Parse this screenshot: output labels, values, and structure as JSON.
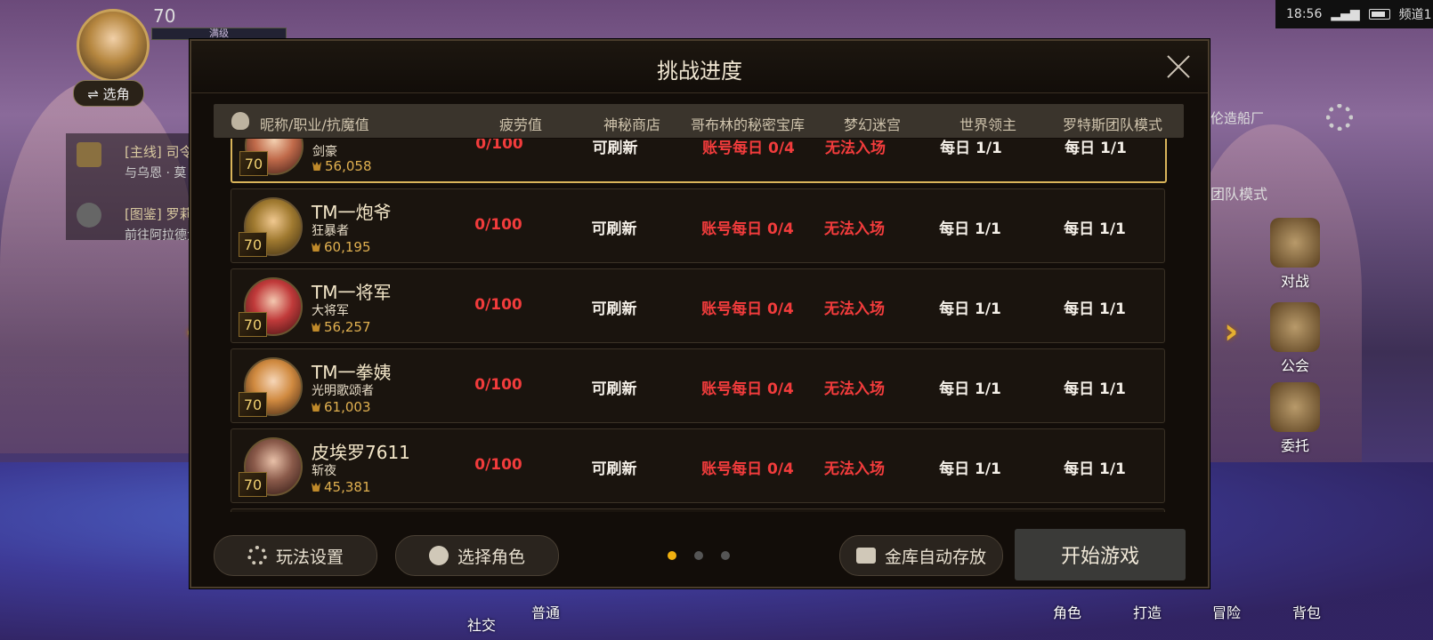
{
  "hud": {
    "level": "70",
    "level_tag": "满级",
    "select_role": "⇌ 选角",
    "time": "18:56",
    "channel": "频道1",
    "side_text_1": "伦造船厂",
    "side_text_2": "团队模式",
    "quests": [
      {
        "title": "[主线] 司令",
        "sub": "与乌恩 · 莫"
      },
      {
        "title": "[图鉴] 罗莉安",
        "sub": "前往阿拉德大"
      }
    ],
    "right_buttons": [
      "对战",
      "公会",
      "委托"
    ],
    "bottom_buttons": [
      "社交",
      "普通",
      "角色",
      "打造",
      "冒险",
      "背包"
    ]
  },
  "modal": {
    "title": "挑战进度",
    "columns": [
      "昵称/职业/抗魔值",
      "疲劳值",
      "神秘商店",
      "哥布林的秘密宝库",
      "梦幻迷宫",
      "世界领主",
      "罗特斯团队模式"
    ],
    "rows": [
      {
        "level": "70",
        "name": "",
        "job": "剑豪",
        "power": "56,058",
        "fatigue": "0/100",
        "shop": "可刷新",
        "goblin": "账号每日 0/4",
        "maze": "无法入场",
        "lord": "每日 1/1",
        "lotus": "每日 1/1"
      },
      {
        "level": "70",
        "name": "TM一炮爷",
        "job": "狂暴者",
        "power": "60,195",
        "fatigue": "0/100",
        "shop": "可刷新",
        "goblin": "账号每日 0/4",
        "maze": "无法入场",
        "lord": "每日 1/1",
        "lotus": "每日 1/1"
      },
      {
        "level": "70",
        "name": "TM一将军",
        "job": "大将军",
        "power": "56,257",
        "fatigue": "0/100",
        "shop": "可刷新",
        "goblin": "账号每日 0/4",
        "maze": "无法入场",
        "lord": "每日 1/1",
        "lotus": "每日 1/1"
      },
      {
        "level": "70",
        "name": "TM一拳姨",
        "job": "光明歌颂者",
        "power": "61,003",
        "fatigue": "0/100",
        "shop": "可刷新",
        "goblin": "账号每日 0/4",
        "maze": "无法入场",
        "lord": "每日 1/1",
        "lotus": "每日 1/1"
      },
      {
        "level": "70",
        "name": "皮埃罗7611",
        "job": "斩夜",
        "power": "45,381",
        "fatigue": "0/100",
        "shop": "可刷新",
        "goblin": "账号每日 0/4",
        "maze": "无法入场",
        "lord": "每日 1/1",
        "lotus": "每日 1/1"
      }
    ],
    "footer": {
      "settings": "玩法设置",
      "select_char": "选择角色",
      "auto_store": "金库自动存放",
      "start": "开始游戏",
      "page_active": 0,
      "page_count": 3
    }
  }
}
